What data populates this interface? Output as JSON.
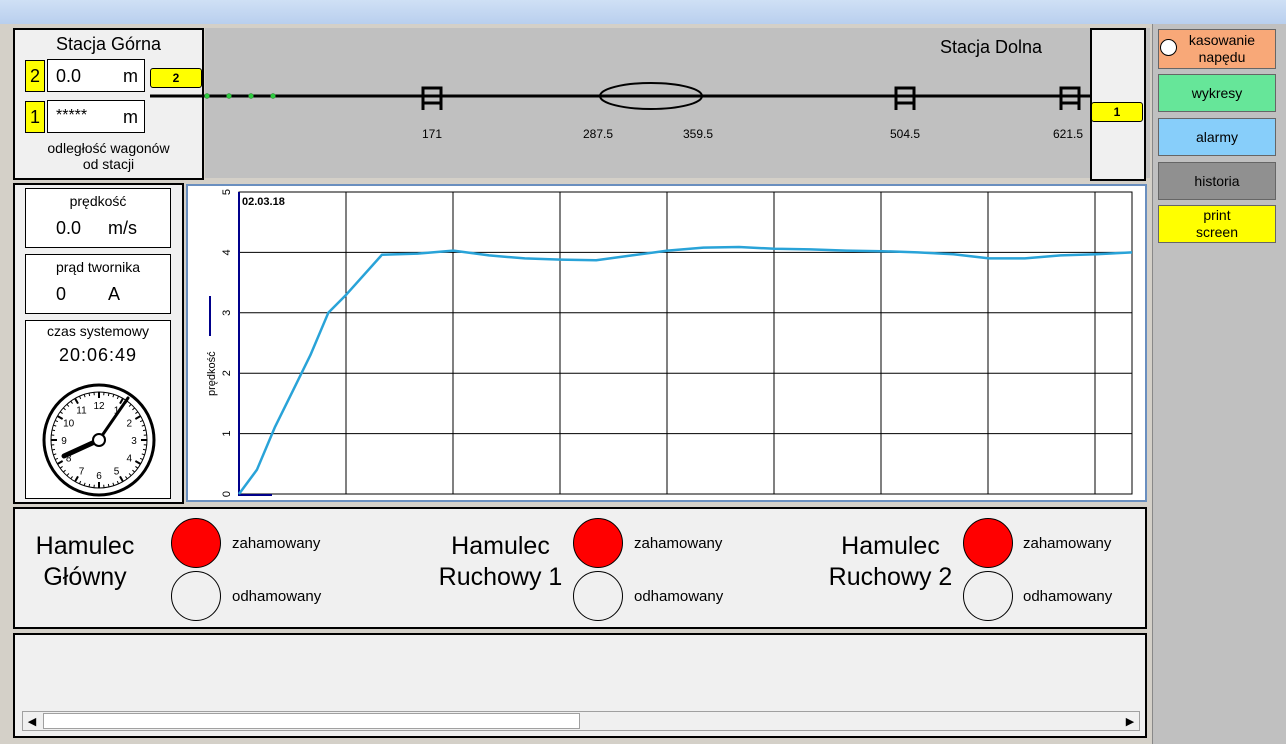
{
  "stations": {
    "upper": {
      "title": "Stacja Górna",
      "rows": [
        {
          "num": "2",
          "value": "0.0",
          "unit": "m"
        },
        {
          "num": "1",
          "value": "*****",
          "unit": "m"
        }
      ],
      "caption_line1": "odległość wagonów",
      "caption_line2": "od stacji"
    },
    "lower": {
      "title": "Stacja Dolna"
    }
  },
  "track": {
    "car_upper_label": "2",
    "car_lower_label": "1",
    "positions": [
      "171",
      "287.5",
      "359.5",
      "504.5",
      "621.5"
    ]
  },
  "readouts": {
    "speed": {
      "label": "prędkość",
      "value": "0.0",
      "unit": "m/s"
    },
    "current": {
      "label": "prąd twornika",
      "value": "0",
      "unit": "A"
    },
    "clock": {
      "label": "czas systemowy",
      "hh": "20",
      "mm": "06",
      "ss": "49",
      "dial_numbers": [
        "12",
        "1",
        "2",
        "3",
        "4",
        "5",
        "6",
        "7",
        "8",
        "9",
        "10",
        "11"
      ]
    }
  },
  "sidebar": {
    "reset_label_line1": "kasowanie",
    "reset_label_line2": "napędu",
    "charts_label": "wykresy",
    "alarms_label": "alarmy",
    "history_label": "historia",
    "print_label_line1": "print",
    "print_label_line2": "screen",
    "colors": {
      "reset": "#f8a878",
      "charts": "#66e699",
      "alarms": "#87cefa",
      "history": "#909090",
      "print": "#ffff00"
    }
  },
  "brakes": [
    {
      "title_line1": "Hamulec",
      "title_line2": "Główny",
      "braked_label": "zahamowany",
      "released_label": "odhamowany",
      "state": "braked"
    },
    {
      "title_line1": "Hamulec",
      "title_line2": "Ruchowy 1",
      "braked_label": "zahamowany",
      "released_label": "odhamowany",
      "state": "braked"
    },
    {
      "title_line1": "Hamulec",
      "title_line2": "Ruchowy 2",
      "braked_label": "zahamowany",
      "released_label": "odhamowany",
      "state": "braked"
    }
  ],
  "chart_data": {
    "type": "line",
    "date_label": "02.03.18",
    "ylabel": "prędkość",
    "ylim": [
      0,
      5
    ],
    "yticks": [
      "0",
      "1",
      "2",
      "3",
      "4",
      "5"
    ],
    "grid": true,
    "series": [
      {
        "color": "#29a3d8",
        "x": [
          0,
          0.5,
          1,
          1.5,
          2,
          2.5,
          3,
          4,
          5,
          6,
          7,
          8,
          9,
          10,
          11,
          12,
          13,
          14,
          15,
          16,
          17,
          18,
          19,
          20,
          21,
          22,
          23,
          24,
          25
        ],
        "y": [
          0,
          0.4,
          1.1,
          1.7,
          2.3,
          3.0,
          3.3,
          3.96,
          3.98,
          4.03,
          3.95,
          3.9,
          3.88,
          3.87,
          3.95,
          4.03,
          4.08,
          4.09,
          4.06,
          4.05,
          4.03,
          4.02,
          4.0,
          3.97,
          3.9,
          3.9,
          3.95,
          3.97,
          4.0
        ]
      }
    ],
    "xlim": [
      0,
      25
    ]
  },
  "colors": {
    "lamp_on": "#ff0000",
    "marker_yellow": "#ffff00"
  }
}
